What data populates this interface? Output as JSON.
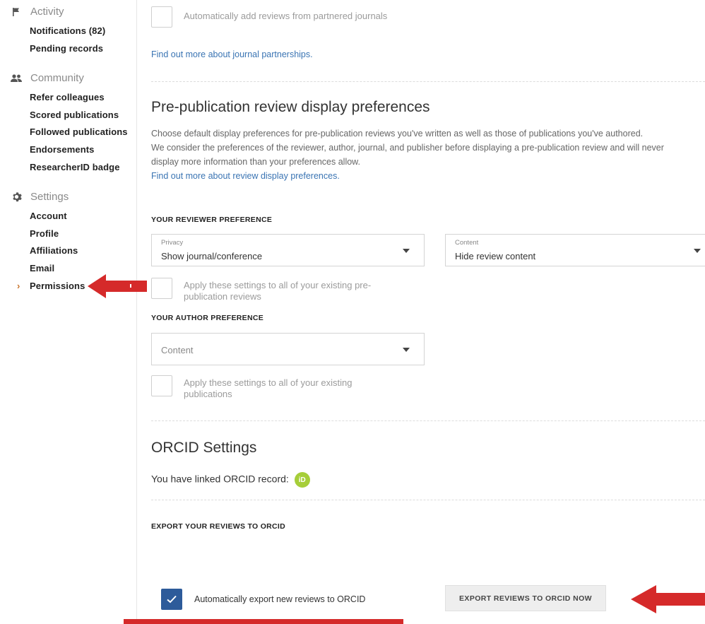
{
  "sidebar": {
    "activity": {
      "title": "Activity",
      "icon": "flag-icon",
      "items": [
        "Notifications (82)",
        "Pending records"
      ]
    },
    "community": {
      "title": "Community",
      "icon": "people-icon",
      "items": [
        "Refer colleagues",
        "Scored publications",
        "Followed publications",
        "Endorsements",
        "ResearcherID badge"
      ]
    },
    "settings": {
      "title": "Settings",
      "icon": "gear-icon",
      "items": [
        "Account",
        "Profile",
        "Affiliations",
        "Email",
        "Permissions"
      ]
    },
    "active_item": "Permissions"
  },
  "journals": {
    "auto_add_label": "Automatically add reviews from partnered journals",
    "auto_add_checked": false,
    "partnerships_link": "Find out more about journal partnerships."
  },
  "prepub": {
    "heading": "Pre-publication review display preferences",
    "desc_line1": "Choose default display preferences for pre-publication reviews you've written as well as those of publications you've authored.",
    "desc_line2": "We consider the preferences of the reviewer, author, journal, and publisher before displaying a pre-publication review and will never display more information than your preferences allow.",
    "desc_link": "Find out more about review display preferences.",
    "reviewer_heading": "YOUR REVIEWER PREFERENCE",
    "privacy_label": "Privacy",
    "privacy_value": "Show journal/conference",
    "content_label": "Content",
    "content_value": "Hide review content",
    "apply_reviews_label": "Apply these settings to all of your existing pre-publication reviews",
    "apply_reviews_checked": false,
    "author_heading": "YOUR AUTHOR PREFERENCE",
    "author_content_placeholder": "Content",
    "apply_pubs_label": "Apply these settings to all of your existing publications",
    "apply_pubs_checked": false
  },
  "orcid": {
    "heading": "ORCID Settings",
    "linked_text": "You have linked ORCID record:",
    "badge": "iD",
    "export_heading": "EXPORT YOUR REVIEWS TO ORCID",
    "auto_export_label": "Automatically export new reviews to ORCID",
    "auto_export_checked": true,
    "export_now_button": "EXPORT REVIEWS TO ORCID NOW"
  },
  "colors": {
    "annotation_red": "#d52a2a",
    "link_blue": "#3a74b3",
    "checkbox_blue": "#2d5b9a",
    "orcid_green": "#a6ce39"
  }
}
